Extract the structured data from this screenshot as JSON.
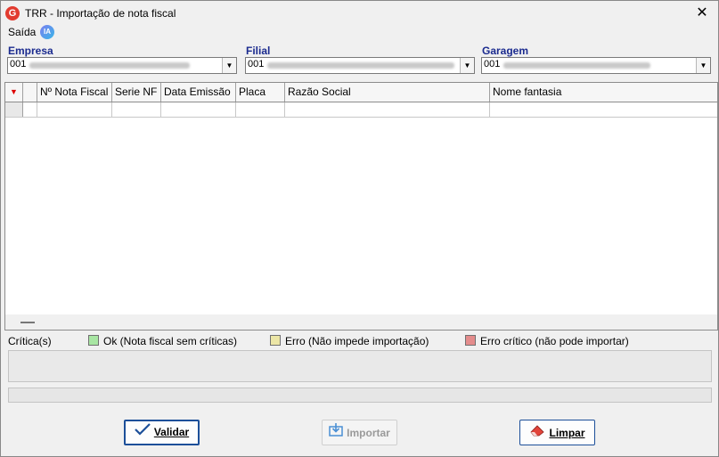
{
  "window": {
    "title": "TRR - Importação de nota fiscal",
    "close": "✕"
  },
  "menu": {
    "saida": "Saída",
    "ia_badge": "IA"
  },
  "fields": {
    "empresa": {
      "label": "Empresa",
      "value": "001"
    },
    "filial": {
      "label": "Filial",
      "value": "001"
    },
    "garagem": {
      "label": "Garagem",
      "value": "001"
    }
  },
  "grid": {
    "columns": [
      "Nº Nota Fiscal",
      "Serie NF",
      "Data Emissão",
      "Placa",
      "Razão Social",
      "Nome fantasia"
    ]
  },
  "legend": {
    "criticas": "Crítica(s)",
    "ok": "Ok (Nota fiscal sem críticas)",
    "erro": "Erro (Não impede importação)",
    "critico": "Erro crítico (não pode importar)"
  },
  "colors": {
    "ok": "#a8e6a3",
    "erro": "#ece6a6",
    "critico": "#e48c8c",
    "accent": "#1b2b8f"
  },
  "buttons": {
    "validar": "Validar",
    "importar": "Importar",
    "limpar": "Limpar"
  }
}
